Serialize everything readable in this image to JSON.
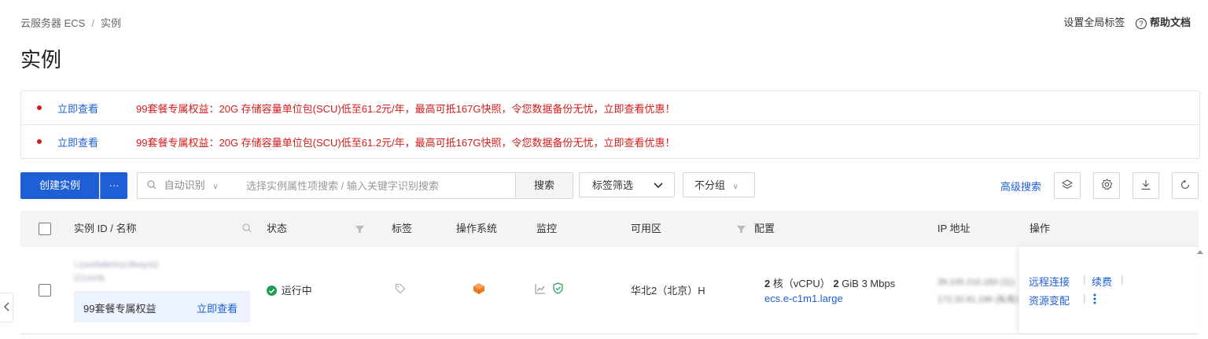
{
  "breadcrumb": {
    "root": "云服务器 ECS",
    "separator": "/",
    "current": "实例"
  },
  "top_actions": {
    "global_tags": "设置全局标签",
    "help_docs": "帮助文档"
  },
  "page_title": "实例",
  "banners": [
    {
      "link": "立即查看",
      "text": "99套餐专属权益：20G 存储容量单位包(SCU)低至61.2元/年，最高可抵167G快照，令您数据备份无忧，立即查看优惠！"
    },
    {
      "link": "立即查看",
      "text": "99套餐专属权益：20G 存储容量单位包(SCU)低至61.2元/年，最高可抵167G快照，令您数据备份无忧，立即查看优惠！"
    }
  ],
  "toolbar": {
    "create_label": "创建实例",
    "more_label": "···",
    "search_mode": "自动识别",
    "search_placeholder": "选择实例属性项搜索 / 输入关键字识别搜索",
    "search_button": "搜索",
    "tag_filter": "标签筛选",
    "group_select": "不分组",
    "advanced_search": "高级搜索"
  },
  "table": {
    "headers": {
      "id": "实例 ID / 名称",
      "status": "状态",
      "tags": "标签",
      "os": "操作系统",
      "monitor": "监控",
      "zone": "可用区",
      "config": "配置",
      "ip": "IP 地址",
      "ops": "操作"
    },
    "rows": [
      {
        "instance_id": "i-2ze0b8e0viz3fwiyxt2",
        "instance_name": "iZ2ze0b",
        "promo_text": "99套餐专属权益",
        "promo_link": "立即查看",
        "status": "运行中",
        "zone": "华北2（北京）H",
        "config_cores": "2",
        "config_cores_unit": "核（vCPU）",
        "config_mem": "2",
        "config_mem_unit": "GiB 3 Mbps",
        "config_spec": "ecs.e-c1m1.large",
        "ip_public": "39.105.210.183 (公)",
        "ip_private": "172.20.81.196 (私有)",
        "op_remote": "远程连接",
        "op_renew": "续费",
        "op_resize": "资源变配"
      }
    ]
  },
  "colors": {
    "primary": "#1f5fd6",
    "alert_red": "#d21b1b",
    "success": "#1f9d55",
    "os_icon": "#f07b22"
  }
}
